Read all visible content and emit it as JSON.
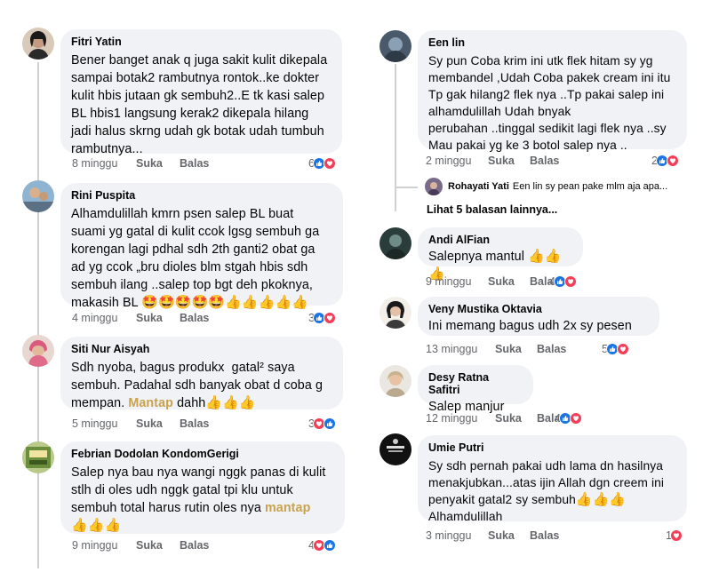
{
  "left": [
    {
      "name": "Fitri Yatin",
      "text": "Bener banget anak q juga sakit kulit dikepala\nsampai botak2 rambutnya rontok..ke dokter\nkulit hbis jutaan gk sembuh2..E tk kasi salep\nBL hbis1 langsung kerak2 dikepala hilang\njadi halus skrng udah gk botak udah tumbuh\nrambutnya...",
      "time": "8 minggu",
      "like": "Suka",
      "reply": "Balas",
      "count": "6"
    },
    {
      "name": "Rini Puspita",
      "text": "Alhamdulillah kmrn psen salep BL buat\nsuami yg gatal di kulit ccok lgsg sembuh ga\nkorengan lagi pdhal sdh 2th ganti2 obat ga\nad yg ccok „bru dioles blm stgah hbis sdh\nsembuh ilang ..salep top bgt deh pkoknya,\nmakasih BL ",
      "emoji": "🤩🤩🤩🤩🤩👍👍👍👍👍",
      "time": "4 minggu",
      "like": "Suka",
      "reply": "Balas",
      "count": "3"
    },
    {
      "name": "Siti Nur Aisyah",
      "text_a": "Sdh nyoba, bagus produkx  gatal² saya\nsembuh. Padahal sdh banyak obat d coba g\nmempan. ",
      "highlight": "Mantap",
      "text_b": " dahh",
      "emoji": "👍👍👍",
      "time": "5 minggu",
      "like": "Suka",
      "reply": "Balas",
      "count": "3"
    },
    {
      "name": "Febrian Dodolan KondomGerigi",
      "text_a": "Salep nya bau nya wangi nggk panas di kulit\nstlh di oles udh nggk gatal tpi klu untuk\nsembuh total harus rutin oles nya ",
      "highlight": "mantap",
      "emoji": "👍👍👍",
      "time": "9 minggu",
      "like": "Suka",
      "reply": "Balas",
      "count": "4"
    }
  ],
  "right": [
    {
      "name": "Een lin",
      "text": "Sy pun Coba krim ini utk flek hitam sy yg\nmembandel ,Udah Coba pakek cream ini itu\nTp gak hilang2 flek nya ..Tp pakai salep ini\nalhamdulillah Udah bnyak\nperubahan ..tinggal sedikit lagi flek nya ..sy\nMau pakai yg ke 3 botol salep nya ..",
      "time": "2 minggu",
      "like": "Suka",
      "reply": "Balas",
      "count": "2",
      "sub_reply": {
        "name": "Rohayati Yati",
        "text": "Een lin sy pean pake mlm aja apa..."
      },
      "more_replies": "Lihat 5 balasan lainnya..."
    },
    {
      "name": "Andi AlFian",
      "text": "Salepnya mantul ",
      "emoji": "👍👍👍",
      "time": "9 minggu",
      "like": "Suka",
      "reply": "Balas",
      "count": "4"
    },
    {
      "name": "Veny Mustika Oktavia",
      "text": "Ini memang bagus udh 2x sy pesen",
      "time": "13 minggu",
      "like": "Suka",
      "reply": "Balas",
      "count": "5"
    },
    {
      "name": "Desy Ratna Safitri",
      "text": "Salep manjur",
      "time": "12 minggu",
      "like": "Suka",
      "reply": "Balas",
      "count": "4"
    },
    {
      "name": "Umie Putri",
      "text": "Sy sdh pernah pakai udh lama dn hasilnya\nmenakjubkan...atas ijin Allah dgn creem ini\npenyakit gatal2 sy sembuh",
      "emoji": "👍👍👍",
      "text_end": "\nAlhamdulillah",
      "time": "3 minggu",
      "like": "Suka",
      "reply": "Balas",
      "count": "1"
    }
  ],
  "colors": {
    "bubble": "#f0f2f5",
    "like": "#1b74e4",
    "love": "#f33e58",
    "meta": "#65676b",
    "highlight": "#c8a24e"
  }
}
